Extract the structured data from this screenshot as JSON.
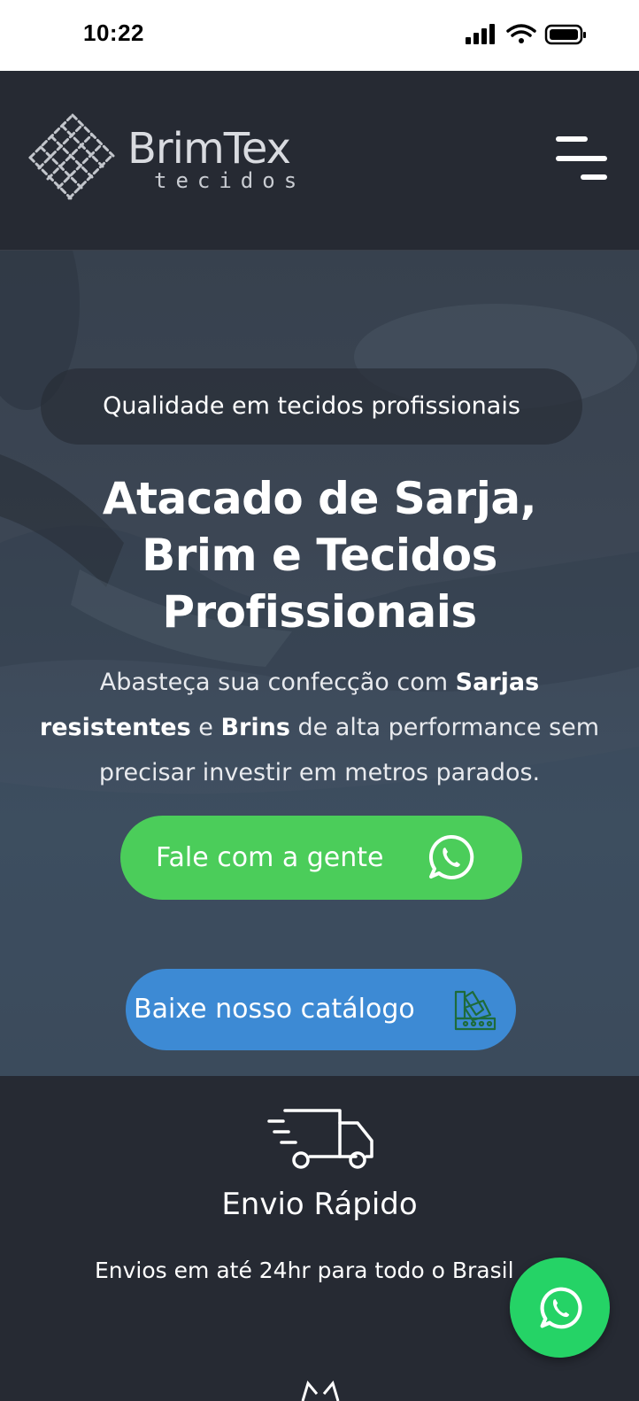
{
  "status_bar": {
    "time": "10:22"
  },
  "brand": {
    "name": "BrimTex",
    "subtitle": "tecidos"
  },
  "hero": {
    "tagline": "Qualidade em tecidos profissionais",
    "title_lines": [
      "Atacado de Sarja,",
      "Brim e Tecidos",
      "Profissionais"
    ],
    "description": {
      "part1": "Abasteça sua confecção com ",
      "bold1": "Sarjas resistentes",
      "part2": " e ",
      "bold2": "Brins",
      "part3": " de alta performance sem precisar investir em metros parados."
    },
    "whatsapp_button": "Fale com a gente",
    "catalog_button": "Baixe nosso catálogo"
  },
  "features": [
    {
      "title": "Envio Rápido",
      "description": "Envios em até 24hr para todo o Brasil",
      "icon": "delivery-truck-icon"
    }
  ],
  "colors": {
    "header_bg": "#262a33",
    "whatsapp_green": "#4bcd5a",
    "catalog_blue": "#3d8ad4",
    "fab_green": "#25d366"
  }
}
